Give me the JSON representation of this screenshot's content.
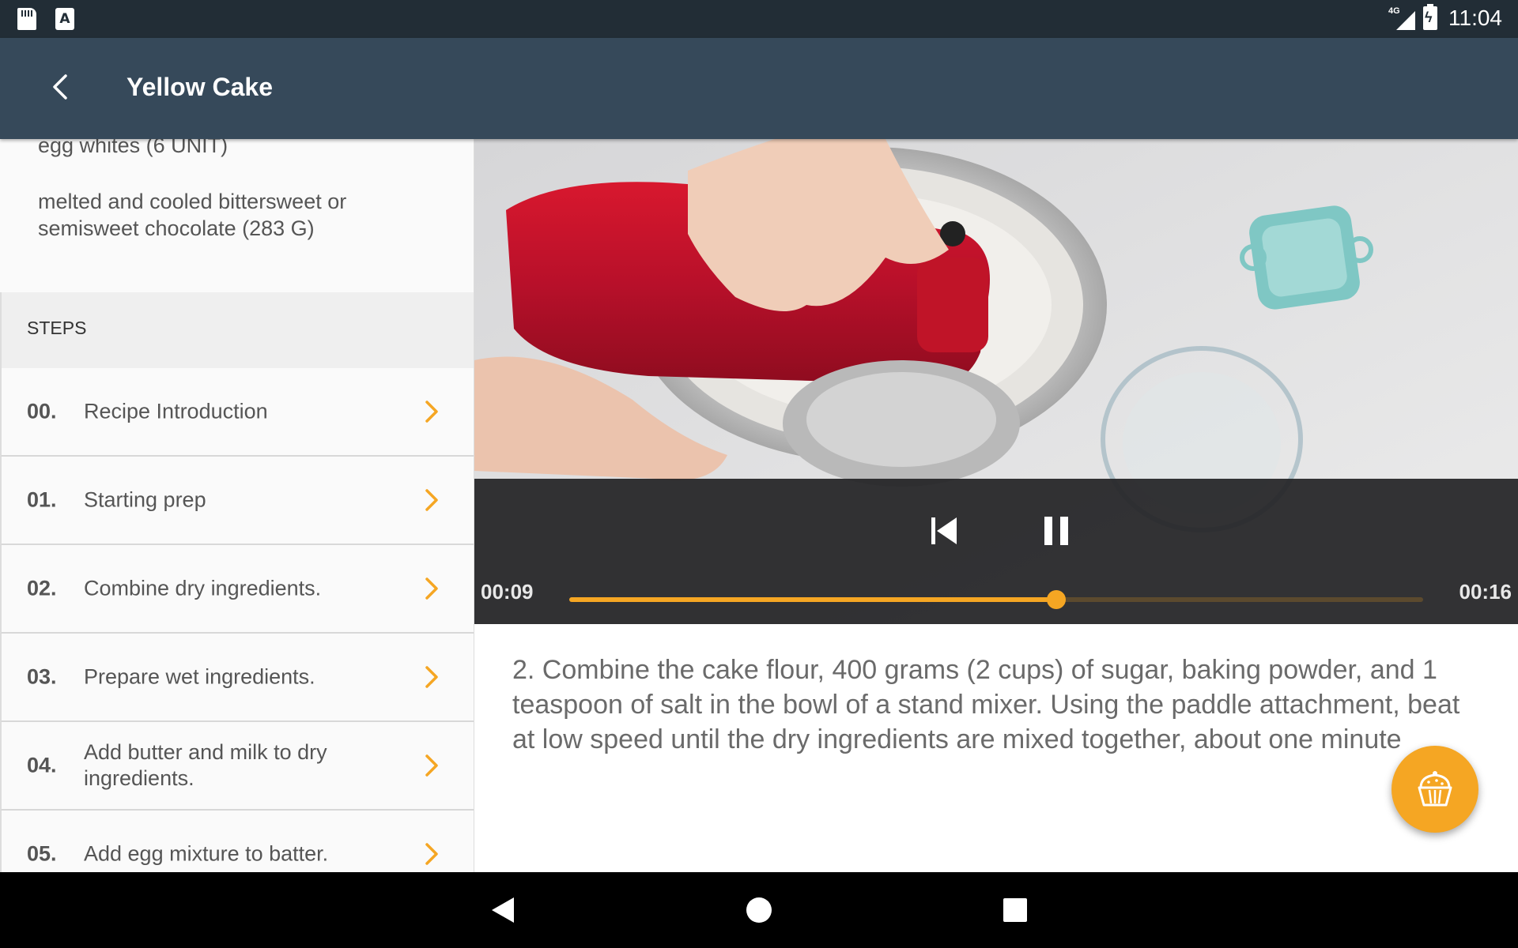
{
  "status_bar": {
    "time": "11:04",
    "network": "4G",
    "icons": [
      "sd-card-icon",
      "a-notification-icon",
      "signal-icon",
      "battery-charging-icon"
    ]
  },
  "toolbar": {
    "title": "Yellow Cake",
    "back_icon": "chevron-left-icon"
  },
  "ingredients": [
    "egg whites (6 UNIT)",
    "melted and cooled bittersweet or semisweet chocolate (283 G)"
  ],
  "steps": {
    "header": "STEPS",
    "items": [
      {
        "num": "00.",
        "label": "Recipe Introduction"
      },
      {
        "num": "01.",
        "label": "Starting prep"
      },
      {
        "num": "02.",
        "label": "Combine dry ingredients."
      },
      {
        "num": "03.",
        "label": "Prepare wet ingredients."
      },
      {
        "num": "04.",
        "label": "Add butter and milk to dry ingredients."
      },
      {
        "num": "05.",
        "label": "Add egg mixture to batter."
      }
    ]
  },
  "player": {
    "elapsed": "00:09",
    "duration": "00:16",
    "progress_fraction": 0.57,
    "accent_color": "#f5a623"
  },
  "description": "2. Combine the cake flour, 400 grams (2 cups) of sugar, baking powder, and 1 teaspoon of salt in the bowl of a stand mixer. Using the paddle attachment, beat at low speed until the dry ingredients are mixed together, about one minute",
  "fab": {
    "icon": "cupcake-icon"
  },
  "colors": {
    "status_bar": "#222d36",
    "toolbar": "#36495a",
    "accent": "#f5a623"
  }
}
